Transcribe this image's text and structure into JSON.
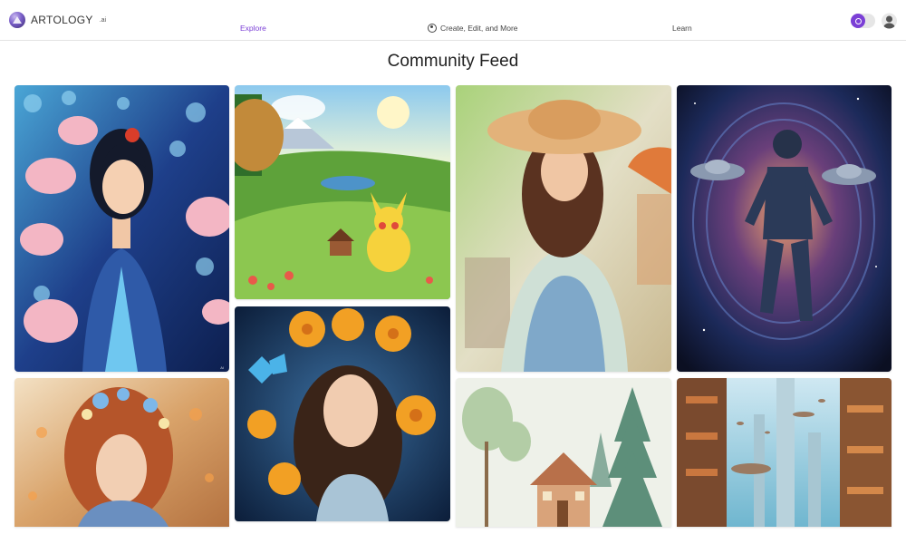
{
  "header": {
    "brand": "ARTOLOGY",
    "brand_suffix": ".ai",
    "nav": {
      "explore": "Explore",
      "create": "Create, Edit, and More",
      "learn": "Learn"
    },
    "icons": {
      "logo": "artology-logo-icon",
      "palette": "palette-icon",
      "theme_toggle": "sun-icon",
      "avatar": "user-avatar-icon"
    },
    "accent_color": "#7b3fd6"
  },
  "page": {
    "title": "Community Feed"
  },
  "feed": {
    "items": [
      {
        "subject": "woman-with-lotus-flowers",
        "caption_right": "AI"
      },
      {
        "subject": "pikachu-in-valley"
      },
      {
        "subject": "woman-in-sun-hat",
        "caption_left": "",
        "caption_right": ""
      },
      {
        "subject": "astronaut-in-space"
      },
      {
        "subject": "woman-with-flower-hair"
      },
      {
        "subject": "woman-with-orange-flowers-and-butterfly"
      },
      {
        "subject": "watercolor-cottage-in-forest"
      },
      {
        "subject": "futuristic-city-towers"
      }
    ]
  }
}
